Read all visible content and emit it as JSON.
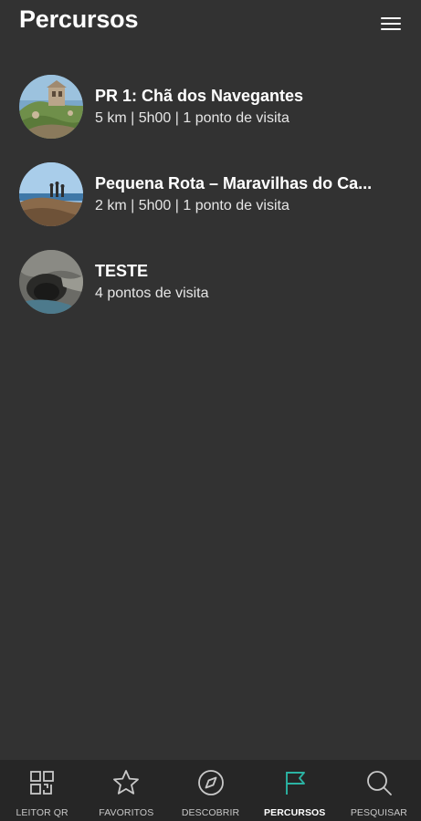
{
  "header": {
    "title": "Percursos",
    "menu_icon": "hamburger-menu-icon"
  },
  "routes": [
    {
      "title": "PR 1: Chã dos Navegantes",
      "subtitle": "5 km | 5h00 | 1 ponto de visita"
    },
    {
      "title": "Pequena Rota – Maravilhas do Ca...",
      "subtitle": "2 km | 5h00 | 1 ponto de visita"
    },
    {
      "title": "TESTE",
      "subtitle": "4 pontos de visita"
    }
  ],
  "bottom_nav": {
    "active": "percursos",
    "active_color": "#2bb3a3",
    "items": [
      {
        "label": "LEITOR QR",
        "icon": "qr-code-icon"
      },
      {
        "label": "FAVORITOS",
        "icon": "star-icon"
      },
      {
        "label": "DESCOBRIR",
        "icon": "compass-icon"
      },
      {
        "label": "PERCURSOS",
        "icon": "flag-icon"
      },
      {
        "label": "PESQUISAR",
        "icon": "search-icon"
      }
    ]
  }
}
